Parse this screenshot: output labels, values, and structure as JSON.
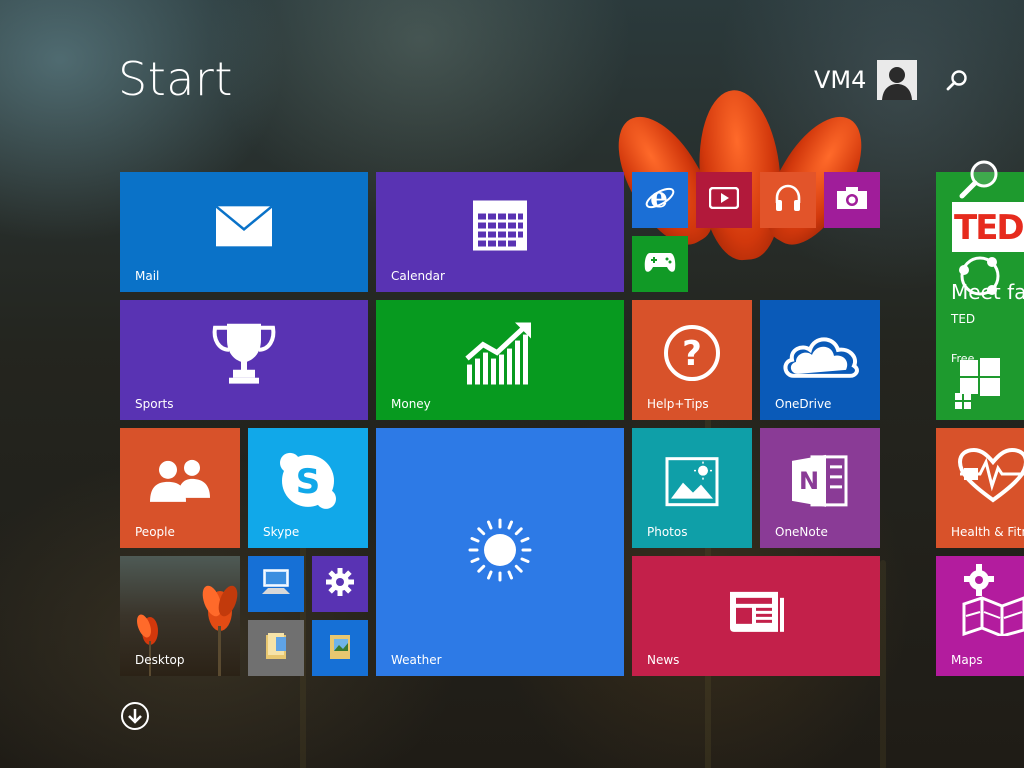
{
  "header": {
    "title": "Start",
    "user_name": "VM4"
  },
  "tiles": {
    "mail": {
      "label": "Mail",
      "color": "#0a72c8"
    },
    "calendar": {
      "label": "Calendar",
      "color": "#5933b3"
    },
    "sports": {
      "label": "Sports",
      "color": "#5933b3"
    },
    "money": {
      "label": "Money",
      "color": "#079a1f"
    },
    "help": {
      "label": "Help+Tips",
      "color": "#d8522a"
    },
    "onedrive": {
      "label": "OneDrive",
      "color": "#0a5ab8"
    },
    "people": {
      "label": "People",
      "color": "#d8522a"
    },
    "skype": {
      "label": "Skype",
      "color": "#11a8e9"
    },
    "weather": {
      "label": "Weather",
      "color": "#2d7ae6"
    },
    "photos": {
      "label": "Photos",
      "color": "#0f9fa8"
    },
    "onenote": {
      "label": "OneNote",
      "color": "#8a3b96"
    },
    "desktop": {
      "label": "Desktop"
    },
    "news": {
      "label": "News",
      "color": "#c3204a"
    },
    "ted": {
      "label": "TED",
      "subtitle": "Meet fas",
      "badge": "Free",
      "color": "#1e9a2e"
    },
    "health": {
      "label": "Health & Fitne",
      "color": "#d8522a"
    },
    "maps": {
      "label": "Maps",
      "color": "#b31c9e"
    },
    "ie": {
      "color": "#1b6fd6"
    },
    "video": {
      "color": "#b2193b"
    },
    "music": {
      "color": "#e2542a"
    },
    "camera": {
      "color": "#a01d9a"
    },
    "games": {
      "color": "#119a26"
    },
    "this_pc": {
      "color": "#1670d6"
    },
    "pc_settings": {
      "color": "#5933b3"
    },
    "file_explorer": {
      "color": "#707070"
    },
    "photo_folder": {
      "color": "#1670d6"
    }
  },
  "icons": {
    "search": "search-icon",
    "apps": "arrow-down-circle-icon",
    "user": "user-avatar"
  }
}
